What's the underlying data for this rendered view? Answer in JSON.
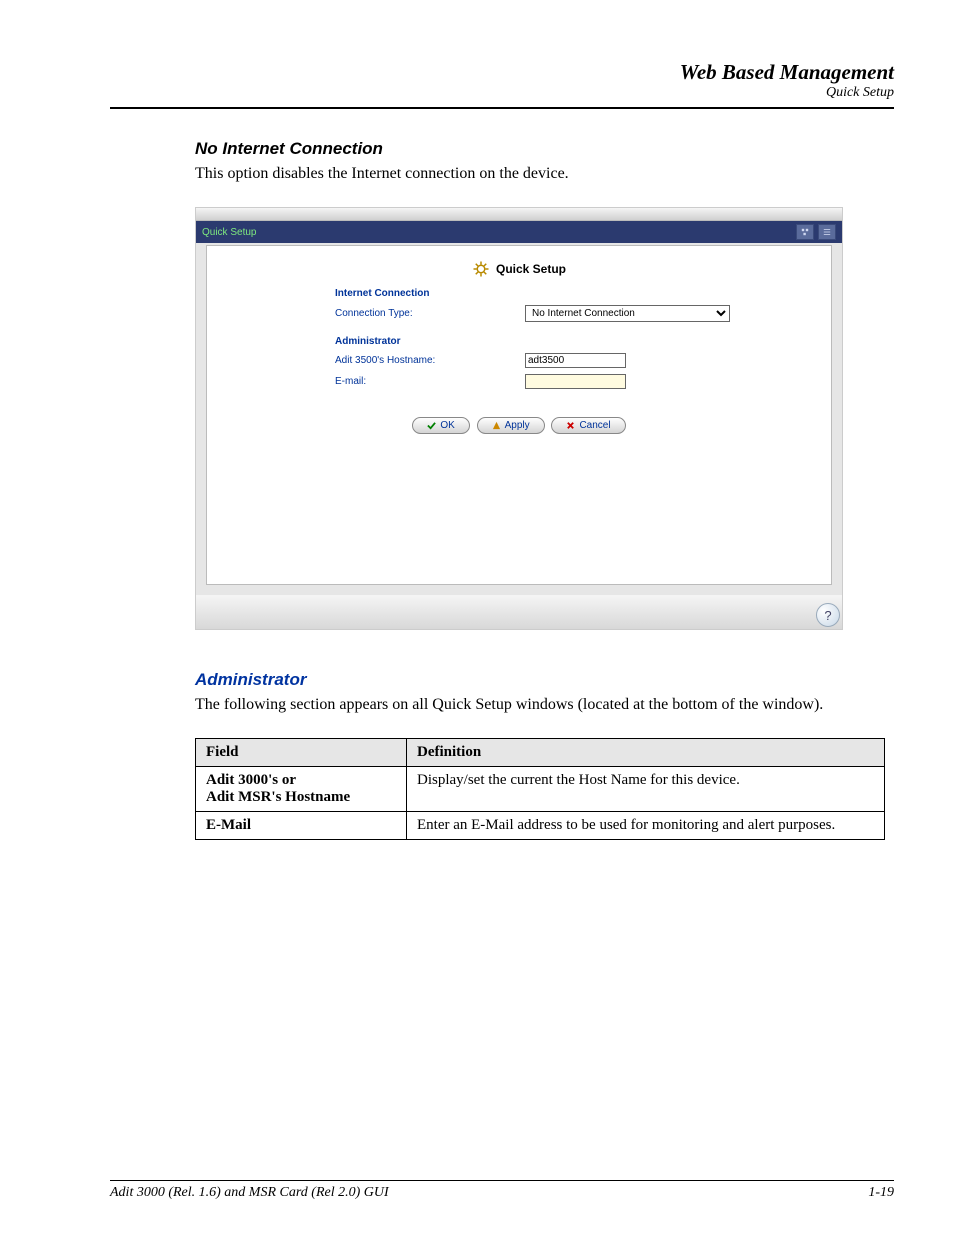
{
  "header": {
    "title": "Web Based Management",
    "subtitle": "Quick Setup"
  },
  "section1": {
    "heading": "No Internet Connection",
    "text": "This option disables the Internet connection on the device."
  },
  "screenshot": {
    "tab": "Quick Setup",
    "title": "Quick Setup",
    "internet": {
      "section": "Internet Connection",
      "conn_label": "Connection Type:",
      "conn_value": "No Internet Connection"
    },
    "admin": {
      "section": "Administrator",
      "host_label": "Adit 3500's Hostname:",
      "host_value": "adt3500",
      "email_label": "E-mail:",
      "email_value": ""
    },
    "buttons": {
      "ok": "OK",
      "apply": "Apply",
      "cancel": "Cancel"
    }
  },
  "section2": {
    "heading": "Administrator",
    "text": "The following section appears on all Quick Setup windows (located at the bottom of the window)."
  },
  "table": {
    "h1": "Field",
    "h2": "Definition",
    "rows": [
      {
        "field": "Adit 3000's or\nAdit MSR's Hostname",
        "def": "Display/set the current the Host Name for this device."
      },
      {
        "field": "E-Mail",
        "def": "Enter an E-Mail address to be used for monitoring and alert purposes."
      }
    ]
  },
  "footer": {
    "left": "Adit 3000 (Rel. 1.6) and MSR Card (Rel 2.0) GUI",
    "right": "1-19"
  }
}
